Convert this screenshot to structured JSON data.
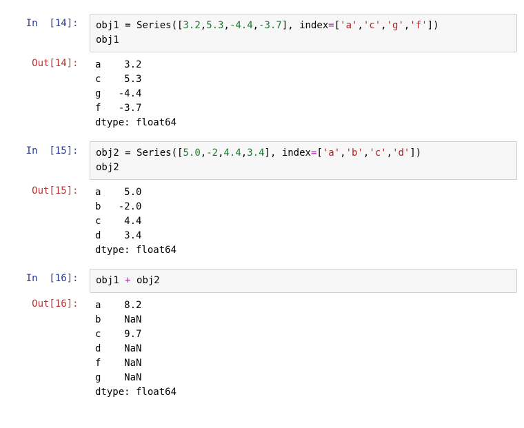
{
  "cells": [
    {
      "in_prompt": "In  [14]: ",
      "out_prompt": "Out[14]: ",
      "input": {
        "line1": {
          "var": "obj1",
          "op_eq": " = ",
          "func": "Series",
          "open": "(",
          "bopen": "[",
          "n1": "3.2",
          "c1": ",",
          "n2": "5.3",
          "c2": ",",
          "n3": "-4.4",
          "c3": ",",
          "n4": "-3.7",
          "bclose": "]",
          "c4": ", ",
          "kw": "index",
          "eq2": "=",
          "b2open": "[",
          "s1": "'a'",
          "cc1": ",",
          "s2": "'c'",
          "cc2": ",",
          "s3": "'g'",
          "cc3": ",",
          "s4": "'f'",
          "b2close": "]",
          "close": ")"
        },
        "line2": "obj1"
      },
      "output": "a    3.2\nc    5.3\ng   -4.4\nf   -3.7\ndtype: float64"
    },
    {
      "in_prompt": "In  [15]: ",
      "out_prompt": "Out[15]: ",
      "input": {
        "line1": {
          "var": "obj2",
          "op_eq": " = ",
          "func": "Series",
          "open": "(",
          "bopen": "[",
          "n1": "5.0",
          "c1": ",",
          "n2": "-2",
          "c2": ",",
          "n3": "4.4",
          "c3": ",",
          "n4": "3.4",
          "bclose": "]",
          "c4": ", ",
          "kw": "index",
          "eq2": "=",
          "b2open": "[",
          "s1": "'a'",
          "cc1": ",",
          "s2": "'b'",
          "cc2": ",",
          "s3": "'c'",
          "cc3": ",",
          "s4": "'d'",
          "b2close": "]",
          "close": ")"
        },
        "line2": "obj2"
      },
      "output": "a    5.0\nb   -2.0\nc    4.4\nd    3.4\ndtype: float64"
    },
    {
      "in_prompt": "In  [16]: ",
      "out_prompt": "Out[16]: ",
      "input_simple": {
        "v1": "obj1",
        "op": " + ",
        "v2": "obj2"
      },
      "output": "a    8.2\nb    NaN\nc    9.7\nd    NaN\nf    NaN\ng    NaN\ndtype: float64"
    }
  ]
}
